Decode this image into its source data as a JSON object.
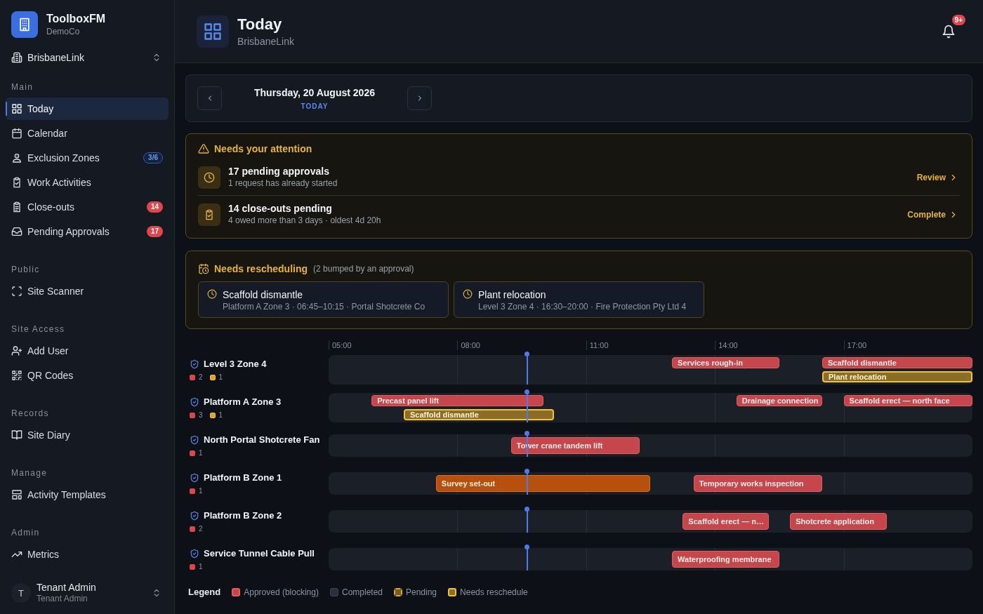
{
  "sidebar": {
    "app": {
      "name": "ToolboxFM",
      "org": "DemoCo"
    },
    "site_selector": {
      "value": "BrisbaneLink"
    },
    "groups": [
      {
        "label": "Main",
        "items": [
          {
            "label": "Today",
            "selected": true
          },
          {
            "label": "Calendar",
            "selected": false
          },
          {
            "label": "Exclusion Zones",
            "selected": false,
            "badge": {
              "text": "3/6",
              "kind": "info"
            }
          },
          {
            "label": "Work Activities",
            "selected": false
          },
          {
            "label": "Close-outs",
            "selected": false,
            "badge": {
              "text": "14",
              "kind": "alert"
            }
          },
          {
            "label": "Pending Approvals",
            "selected": false,
            "badge": {
              "text": "17",
              "kind": "alert"
            }
          }
        ]
      },
      {
        "label": "Public",
        "items": [
          {
            "label": "Site Scanner",
            "selected": false
          }
        ]
      },
      {
        "label": "Site Access",
        "items": [
          {
            "label": "Add User",
            "selected": false
          },
          {
            "label": "QR Codes",
            "selected": false
          }
        ]
      },
      {
        "label": "Records",
        "items": [
          {
            "label": "Site Diary",
            "selected": false
          }
        ]
      },
      {
        "label": "Manage",
        "items": [
          {
            "label": "Activity Templates",
            "selected": false
          }
        ]
      },
      {
        "label": "Admin",
        "items": [
          {
            "label": "Metrics",
            "selected": false
          }
        ]
      }
    ],
    "user": {
      "initial": "T",
      "name": "Tenant Admin",
      "role": "Tenant Admin"
    }
  },
  "header": {
    "title": "Today",
    "subtitle": "BrisbaneLink",
    "notifications": "9+"
  },
  "date_nav": {
    "date": "Thursday, 20 August 2026",
    "label": "TODAY"
  },
  "attention": {
    "title": "Needs your attention",
    "items": [
      {
        "title": "17 pending approvals",
        "detail": "1 request has already started",
        "action": "Review"
      },
      {
        "title": "14 close-outs pending",
        "detail": "4 owed more than 3 days · oldest 4d 20h",
        "action": "Complete"
      }
    ]
  },
  "rescheduling": {
    "title": "Needs rescheduling",
    "note": "(2 bumped by an approval)",
    "items": [
      {
        "title": "Scaffold dismantle",
        "detail": "Platform A Zone 3 · 06:45–10:15 · Portal Shotcrete Co"
      },
      {
        "title": "Plant relocation",
        "detail": "Level 3 Zone 4 · 16:30–20:00 · Fire Protection Pty Ltd 4"
      }
    ]
  },
  "timeline": {
    "ticks": [
      "05:00",
      "08:00",
      "11:00",
      "14:00",
      "17:00"
    ],
    "zones": [
      {
        "name": "Level 3 Zone 4",
        "counts": [
          {
            "kind": "approved",
            "value": "2"
          },
          {
            "kind": "reschedule",
            "value": "1"
          }
        ],
        "bars": [
          {
            "label": "Services rough-in",
            "kind": "approved"
          },
          {
            "label": "Scaffold dismantle",
            "kind": "approved"
          },
          {
            "label": "Plant relocation",
            "kind": "reschedule"
          }
        ]
      },
      {
        "name": "Platform A Zone 3",
        "counts": [
          {
            "kind": "approved",
            "value": "3"
          },
          {
            "kind": "reschedule",
            "value": "1"
          }
        ],
        "bars": [
          {
            "label": "Precast panel lift",
            "kind": "approved"
          },
          {
            "label": "Scaffold dismantle",
            "kind": "reschedule"
          },
          {
            "label": "Drainage connection",
            "kind": "approved"
          },
          {
            "label": "Scaffold erect — north face",
            "kind": "approved"
          }
        ]
      },
      {
        "name": "North Portal Shotcrete Fan",
        "counts": [
          {
            "kind": "approved",
            "value": "1"
          }
        ],
        "bars": [
          {
            "label": "Tower crane tandem lift",
            "kind": "approved"
          }
        ]
      },
      {
        "name": "Platform B Zone 1",
        "counts": [
          {
            "kind": "approved",
            "value": "1"
          }
        ],
        "bars": [
          {
            "label": "Survey set-out",
            "kind": "started"
          },
          {
            "label": "Temporary works inspection",
            "kind": "approved"
          }
        ]
      },
      {
        "name": "Platform B Zone 2",
        "counts": [
          {
            "kind": "approved",
            "value": "2"
          }
        ],
        "bars": [
          {
            "label": "Scaffold erect — n…",
            "kind": "approved"
          },
          {
            "label": "Shotcrete application",
            "kind": "approved"
          }
        ]
      },
      {
        "name": "Service Tunnel Cable Pull",
        "counts": [
          {
            "kind": "approved",
            "value": "1"
          }
        ],
        "bars": [
          {
            "label": "Waterproofing membrane",
            "kind": "approved"
          }
        ]
      }
    ],
    "legend": {
      "title": "Legend",
      "items": [
        {
          "kind": "approved",
          "label": "Approved (blocking)"
        },
        {
          "kind": "completed",
          "label": "Completed"
        },
        {
          "kind": "pending",
          "label": "Pending"
        },
        {
          "kind": "reschedule",
          "label": "Needs reschedule"
        }
      ]
    }
  }
}
